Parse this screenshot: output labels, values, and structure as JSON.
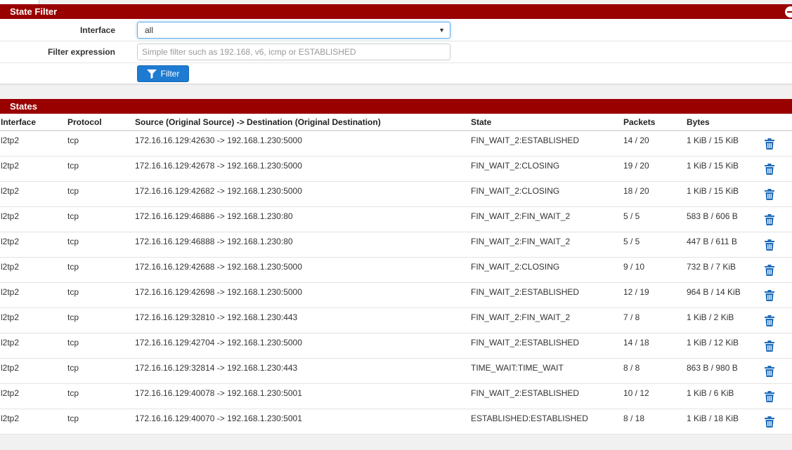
{
  "state_filter": {
    "title": "State Filter",
    "interface_label": "Interface",
    "interface_value": "all",
    "filter_expression_label": "Filter expression",
    "filter_expression_value": "",
    "filter_expression_placeholder": "Simple filter such as 192.168, v6, icmp or ESTABLISHED",
    "filter_button_label": "Filter"
  },
  "states": {
    "title": "States",
    "columns": [
      "Interface",
      "Protocol",
      "Source (Original Source) -> Destination (Original Destination)",
      "State",
      "Packets",
      "Bytes"
    ],
    "rows": [
      {
        "interface": "l2tp2",
        "protocol": "tcp",
        "src_dst": "172.16.16.129:42630 -> 192.168.1.230:5000",
        "state": "FIN_WAIT_2:ESTABLISHED",
        "packets": "14 / 20",
        "bytes": "1 KiB / 15 KiB"
      },
      {
        "interface": "l2tp2",
        "protocol": "tcp",
        "src_dst": "172.16.16.129:42678 -> 192.168.1.230:5000",
        "state": "FIN_WAIT_2:CLOSING",
        "packets": "19 / 20",
        "bytes": "1 KiB / 15 KiB"
      },
      {
        "interface": "l2tp2",
        "protocol": "tcp",
        "src_dst": "172.16.16.129:42682 -> 192.168.1.230:5000",
        "state": "FIN_WAIT_2:CLOSING",
        "packets": "18 / 20",
        "bytes": "1 KiB / 15 KiB"
      },
      {
        "interface": "l2tp2",
        "protocol": "tcp",
        "src_dst": "172.16.16.129:46886 -> 192.168.1.230:80",
        "state": "FIN_WAIT_2:FIN_WAIT_2",
        "packets": "5 / 5",
        "bytes": "583 B / 606 B"
      },
      {
        "interface": "l2tp2",
        "protocol": "tcp",
        "src_dst": "172.16.16.129:46888 -> 192.168.1.230:80",
        "state": "FIN_WAIT_2:FIN_WAIT_2",
        "packets": "5 / 5",
        "bytes": "447 B / 611 B"
      },
      {
        "interface": "l2tp2",
        "protocol": "tcp",
        "src_dst": "172.16.16.129:42688 -> 192.168.1.230:5000",
        "state": "FIN_WAIT_2:CLOSING",
        "packets": "9 / 10",
        "bytes": "732 B / 7 KiB"
      },
      {
        "interface": "l2tp2",
        "protocol": "tcp",
        "src_dst": "172.16.16.129:42698 -> 192.168.1.230:5000",
        "state": "FIN_WAIT_2:ESTABLISHED",
        "packets": "12 / 19",
        "bytes": "964 B / 14 KiB"
      },
      {
        "interface": "l2tp2",
        "protocol": "tcp",
        "src_dst": "172.16.16.129:32810 -> 192.168.1.230:443",
        "state": "FIN_WAIT_2:FIN_WAIT_2",
        "packets": "7 / 8",
        "bytes": "1 KiB / 2 KiB"
      },
      {
        "interface": "l2tp2",
        "protocol": "tcp",
        "src_dst": "172.16.16.129:42704 -> 192.168.1.230:5000",
        "state": "FIN_WAIT_2:ESTABLISHED",
        "packets": "14 / 18",
        "bytes": "1 KiB / 12 KiB"
      },
      {
        "interface": "l2tp2",
        "protocol": "tcp",
        "src_dst": "172.16.16.129:32814 -> 192.168.1.230:443",
        "state": "TIME_WAIT:TIME_WAIT",
        "packets": "8 / 8",
        "bytes": "863 B / 980 B"
      },
      {
        "interface": "l2tp2",
        "protocol": "tcp",
        "src_dst": "172.16.16.129:40078 -> 192.168.1.230:5001",
        "state": "FIN_WAIT_2:ESTABLISHED",
        "packets": "10 / 12",
        "bytes": "1 KiB / 6 KiB"
      },
      {
        "interface": "l2tp2",
        "protocol": "tcp",
        "src_dst": "172.16.16.129:40070 -> 192.168.1.230:5001",
        "state": "ESTABLISHED:ESTABLISHED",
        "packets": "8 / 18",
        "bytes": "1 KiB / 18 KiB"
      }
    ]
  },
  "icons": {
    "filter": "funnel-icon",
    "delete": "trash-icon",
    "collapse": "minus-circle-icon",
    "dropdown": "caret-down-icon"
  },
  "colors": {
    "heading_bg": "#990000",
    "button_bg": "#1e7bd1",
    "trash_icon": "#1e6bb8"
  }
}
